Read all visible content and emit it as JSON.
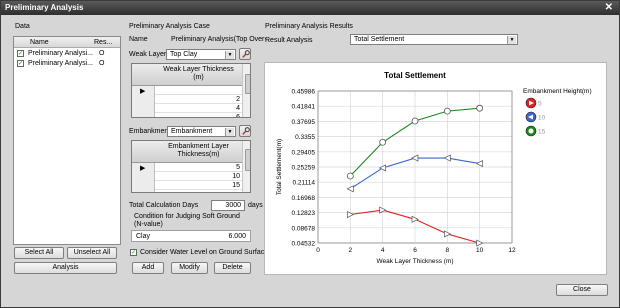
{
  "window": {
    "title": "Preliminary Analysis",
    "close_glyph": "✕"
  },
  "data_panel": {
    "group_label": "Data",
    "columns": [
      "Name",
      "Res..."
    ],
    "rows": [
      {
        "name": "Preliminary Analysi...",
        "result": "O",
        "checked": true
      },
      {
        "name": "Preliminary Analysi...",
        "result": "O",
        "checked": true
      }
    ],
    "select_all": "Select All",
    "unselect_all": "Unselect All",
    "analysis": "Analysis"
  },
  "case_panel": {
    "group_label": "Preliminary Analysis Case",
    "name_label": "Name",
    "name_value": "Preliminary Analysis(Top Over-",
    "weak_layer_label": "Weak Layer",
    "weak_layer_value": "Top Clay",
    "weak_grid_header": "Weak Layer Thickness\n(m)",
    "weak_grid_values": [
      "2",
      "4",
      "6"
    ],
    "embankment_label": "Embankment",
    "embankment_value": "Embankment",
    "emb_grid_header": "Embankment Layer\nThickness(m)",
    "emb_grid_values": [
      "5",
      "10",
      "15"
    ],
    "total_days_label": "Total Calculation Days",
    "total_days_value": "3000",
    "days_unit": "days",
    "condition_label": "Condition for Judging Soft Ground\n(N-value)",
    "clay_label": "Clay",
    "clay_value": "6.000",
    "water_level_label": "Consider Water Level on Ground Surface",
    "water_level_checked": true,
    "add": "Add",
    "modify": "Modify",
    "delete": "Delete"
  },
  "results_panel": {
    "group_label": "Preliminary Analysis Results",
    "result_analysis_label": "Result Analysis",
    "result_analysis_value": "Total Settlement"
  },
  "footer": {
    "close": "Close"
  },
  "icons": {
    "tool": "wrench-icon",
    "arrow": "row-pointer-icon",
    "check": "check-icon"
  },
  "chart_data": {
    "type": "line",
    "title": "Total Settlement",
    "xlabel": "Weak Layer Thickness (m)",
    "ylabel": "Total Settlement(m)",
    "x_ticks": [
      0,
      2,
      4,
      6,
      8,
      10,
      12
    ],
    "xlim": [
      0,
      12
    ],
    "y_ticks": [
      "0.04532",
      "0.08678",
      "0.12823",
      "0.16968",
      "0.21114",
      "0.25259",
      "0.29405",
      "0.3355",
      "0.37695",
      "0.41841",
      "0.45986"
    ],
    "ylim": [
      0.04532,
      0.45986
    ],
    "grid": true,
    "legend_title": "Embankment Height(m)",
    "legend_position": "right",
    "x": [
      2,
      4,
      6,
      8,
      10
    ],
    "series": [
      {
        "name": "5",
        "color": "#e02020",
        "marker": "triangle-right",
        "values": [
          0.123,
          0.135,
          0.11,
          0.07,
          0.045
        ]
      },
      {
        "name": "10",
        "color": "#3a66d0",
        "marker": "triangle-left",
        "values": [
          0.193,
          0.25,
          0.277,
          0.277,
          0.262
        ]
      },
      {
        "name": "15",
        "color": "#1a8a1a",
        "marker": "circle",
        "values": [
          0.228,
          0.32,
          0.378,
          0.405,
          0.413
        ]
      }
    ]
  }
}
